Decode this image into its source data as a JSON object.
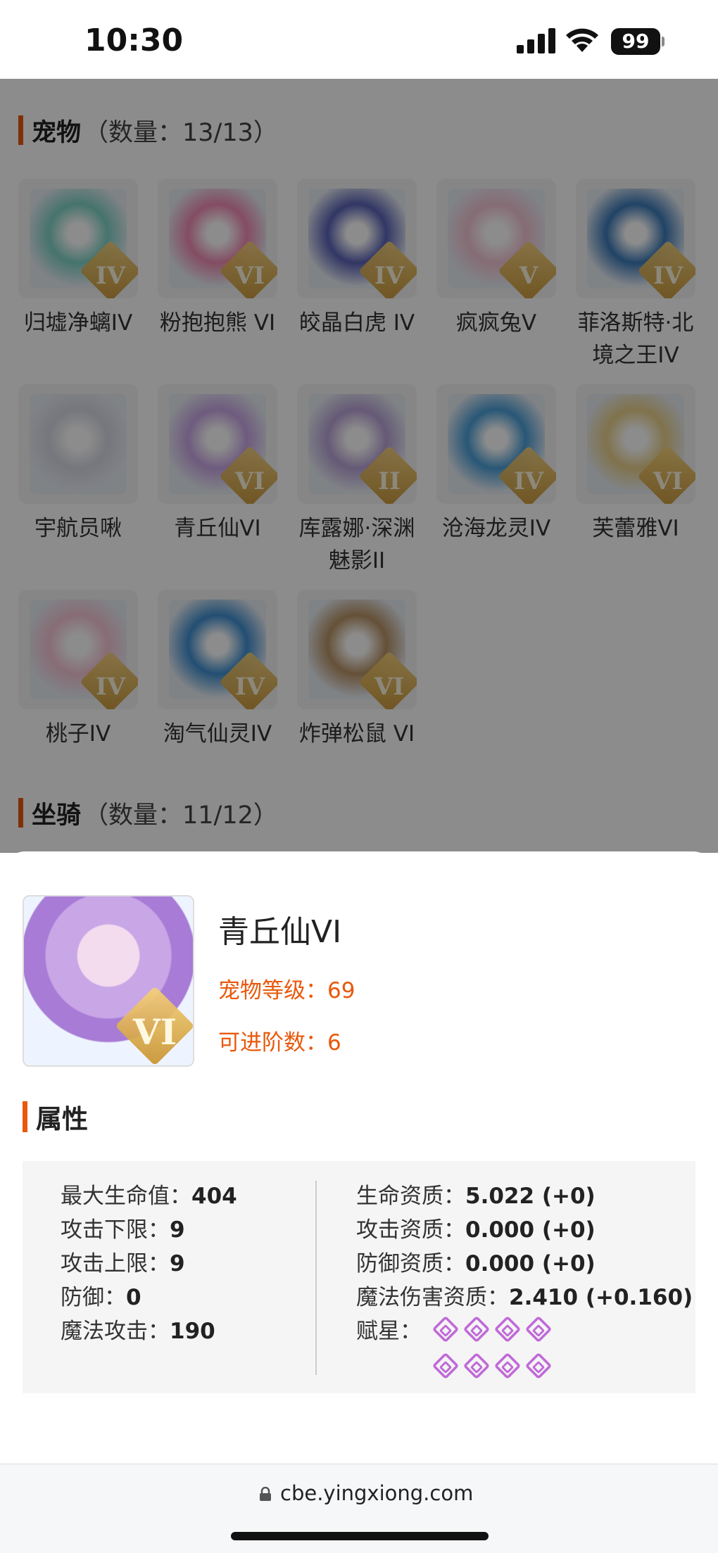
{
  "status_bar": {
    "time": "10:30",
    "battery": "99"
  },
  "pets_section": {
    "title": "宠物",
    "count": "（数量：13/13）",
    "items": [
      {
        "name": "归墟净螭IV",
        "grade": "IV",
        "color": "#7fd3c6"
      },
      {
        "name": "粉抱抱熊 VI",
        "grade": "VI",
        "color": "#f08bb3"
      },
      {
        "name": "皎晶白虎 IV",
        "grade": "IV",
        "color": "#5a63b8"
      },
      {
        "name": "疯疯兔V",
        "grade": "V",
        "color": "#f4c5d4"
      },
      {
        "name": "菲洛斯特·北境之王IV",
        "grade": "IV",
        "color": "#3c7ab9"
      },
      {
        "name": "宇航员啾",
        "grade": "",
        "color": "#d7d9e4"
      },
      {
        "name": "青丘仙VI",
        "grade": "VI",
        "color": "#c9a6e6"
      },
      {
        "name": "库露娜·深渊魅影II",
        "grade": "II",
        "color": "#b9a3d8"
      },
      {
        "name": "沧海龙灵IV",
        "grade": "IV",
        "color": "#4a9fd8"
      },
      {
        "name": "芙蕾雅VI",
        "grade": "VI",
        "color": "#e9d18a"
      },
      {
        "name": "桃子IV",
        "grade": "IV",
        "color": "#f7c6d5"
      },
      {
        "name": "淘气仙灵IV",
        "grade": "IV",
        "color": "#3f8fd1"
      },
      {
        "name": "炸弹松鼠 VI",
        "grade": "VI",
        "color": "#b99366"
      }
    ]
  },
  "mounts_section": {
    "title": "坐骑",
    "count": "（数量：11/12）"
  },
  "detail": {
    "name": "青丘仙VI",
    "grade": "VI",
    "level_label": "宠物等级：",
    "level": "69",
    "advance_label": "可进阶数：",
    "advance": "6",
    "attributes_title": "属性",
    "left_stats": [
      {
        "label": "最大生命值：",
        "value": "404"
      },
      {
        "label": "攻击下限：",
        "value": "9"
      },
      {
        "label": "攻击上限：",
        "value": "9"
      },
      {
        "label": "防御：",
        "value": "0"
      },
      {
        "label": "魔法攻击：",
        "value": "190"
      }
    ],
    "right_stats": [
      {
        "label": "生命资质：",
        "value": "5.022 (+0)"
      },
      {
        "label": "攻击资质：",
        "value": "0.000 (+0)"
      },
      {
        "label": "防御资质：",
        "value": "0.000 (+0)"
      },
      {
        "label": "魔法伤害资质：",
        "value": "2.410 (+0.160)"
      }
    ],
    "stars_label": "赋星：",
    "star_count": 8,
    "star_color": "#c06ad8"
  },
  "browser": {
    "url": "cbe.yingxiong.com"
  },
  "colors": {
    "accent": "#e8590c"
  }
}
